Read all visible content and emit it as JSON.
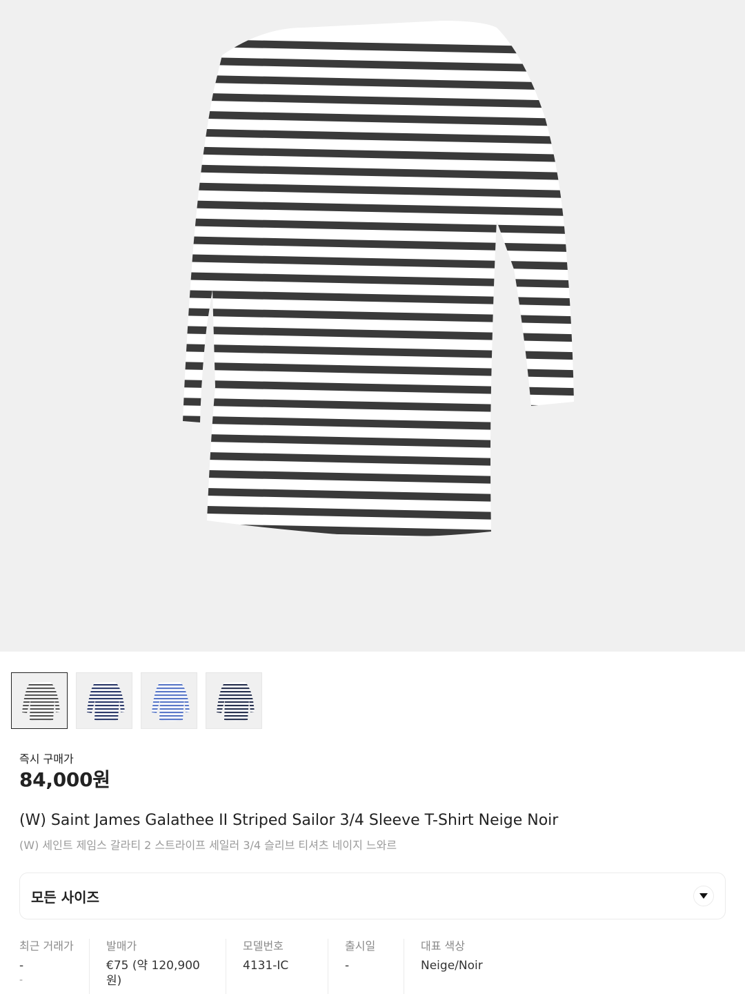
{
  "product_image": {
    "icon": "striped-tshirt-image",
    "colors": {
      "background": "#f0f0f0",
      "stripe": "#3a3a3a",
      "fabric": "#ffffff"
    }
  },
  "thumbnails": [
    {
      "name": "thumb-neige-noir",
      "stripe_color": "#555555",
      "selected": true
    },
    {
      "name": "thumb-navy",
      "stripe_color": "#2c3a6a",
      "selected": false
    },
    {
      "name": "thumb-blue",
      "stripe_color": "#5a78c8",
      "selected": false
    },
    {
      "name": "thumb-dark-navy",
      "stripe_color": "#27314f",
      "selected": false
    }
  ],
  "price": {
    "label": "즉시 구매가",
    "value": "84,000원"
  },
  "title": {
    "english": "(W) Saint James Galathee II Striped Sailor 3/4 Sleeve T-Shirt Neige Noir",
    "korean": "(W) 세인트 제임스 갈라티 2 스트라이프 세일러 3/4 슬리브 티셔츠 네이지 느와르"
  },
  "size_selector": {
    "label": "모든 사이즈",
    "icon": "chevron-down-icon"
  },
  "info": {
    "recent_trade": {
      "label": "최근 거래가",
      "value": "-",
      "sub": "-"
    },
    "release_price": {
      "label": "발매가",
      "value": "€75 (약 120,900원)"
    },
    "model_number": {
      "label": "모델번호",
      "value": "4131-IC"
    },
    "release_date": {
      "label": "출시일",
      "value": "-"
    },
    "color": {
      "label": "대표 색상",
      "value": "Neige/Noir"
    }
  }
}
